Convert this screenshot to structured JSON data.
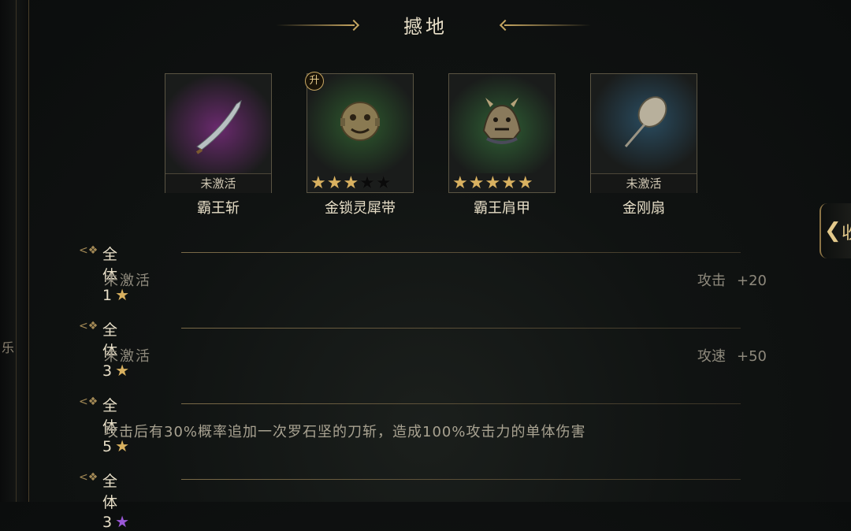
{
  "panel": {
    "title": "撼地"
  },
  "side": {
    "left_glyph": "乐",
    "right_tab": "收"
  },
  "items": [
    {
      "name": "霸王斩",
      "status": "未激活",
      "icon": "green-dragon-blade-icon",
      "glow": "#6a2a6e"
    },
    {
      "name": "金锁灵犀带",
      "badge": "升",
      "stars_filled": 3,
      "stars_total": 5,
      "icon": "beast-face-belt-icon",
      "glow": "#2e5a2e"
    },
    {
      "name": "霸王肩甲",
      "stars_filled": 5,
      "stars_total": 5,
      "icon": "demon-pauldron-icon",
      "glow": "#2f5f34"
    },
    {
      "name": "金刚扇",
      "status": "未激活",
      "icon": "war-fan-icon",
      "glow": "#2a4c60"
    }
  ],
  "bonuses": [
    {
      "label": "全体1",
      "star_color": "#d9b160",
      "desc": "未激活",
      "stat": "攻击",
      "value": "+20"
    },
    {
      "label": "全体3",
      "star_color": "#d9b160",
      "desc": "未激活",
      "stat": "攻速",
      "value": "+50"
    },
    {
      "label": "全体5",
      "star_color": "#d9b160",
      "desc": "攻击后有30%概率追加一次罗石坚的刀斩，造成100%攻击力的单体伤害"
    },
    {
      "label": "全体3",
      "star_color": "#9a58d8"
    }
  ]
}
